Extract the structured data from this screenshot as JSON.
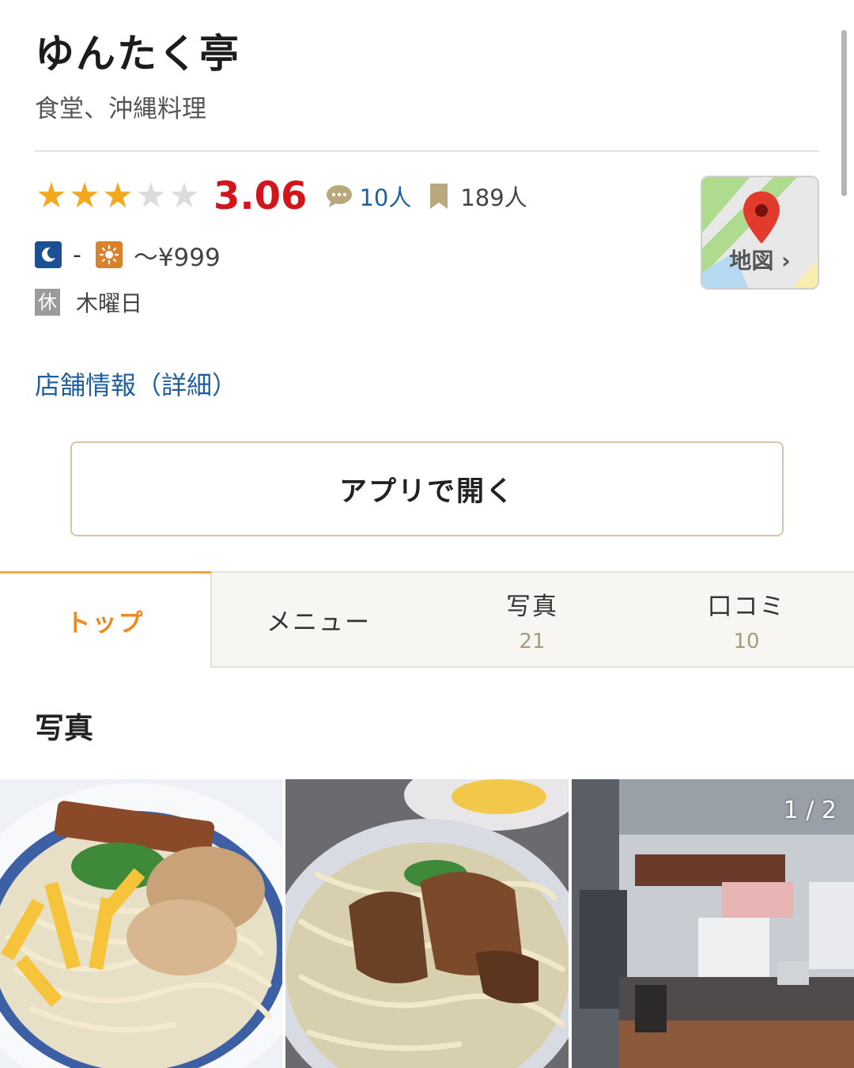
{
  "shop": {
    "name": "ゆんたく亭",
    "genre": "食堂、沖縄料理",
    "rating": "3.06",
    "rating_value": 3.06,
    "review_count": "10人",
    "save_count": "189人",
    "dinner_price": "-",
    "lunch_price": "～¥999",
    "holiday_badge": "休",
    "holiday": "木曜日"
  },
  "map_button": {
    "label": "地図 ›"
  },
  "detail_link": "店舗情報（詳細）",
  "app_button": "アプリで開く",
  "tabs": [
    {
      "label": "トップ",
      "count": ""
    },
    {
      "label": "メニュー",
      "count": ""
    },
    {
      "label": "写真",
      "count": "21"
    },
    {
      "label": "口コミ",
      "count": "10"
    }
  ],
  "photos_section": {
    "title": "写真",
    "counter": "1 / 2"
  },
  "colors": {
    "star": "#f4a81d",
    "score": "#d2141b",
    "link": "#1f5f9f",
    "active_tab": "#ee8b20"
  }
}
